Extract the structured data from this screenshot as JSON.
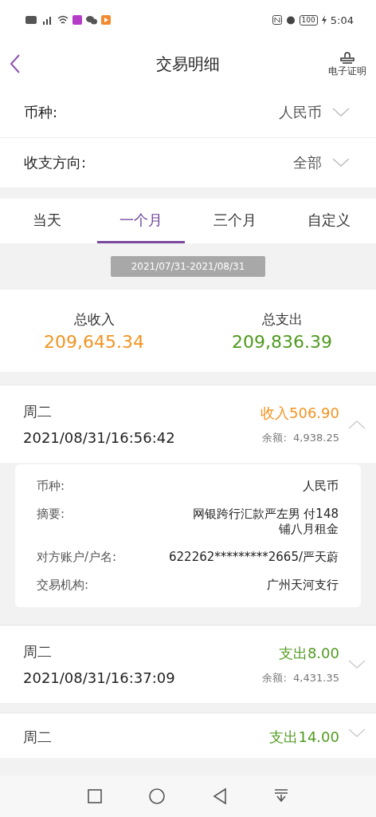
{
  "status_bar": {
    "time": "5:04",
    "battery": "100"
  },
  "header": {
    "title": "交易明细",
    "action": "电子证明"
  },
  "filters": [
    {
      "label": "币种:",
      "value": "人民币"
    },
    {
      "label": "收支方向:",
      "value": "全部"
    }
  ],
  "tabs": [
    {
      "label": "当天",
      "selected": false
    },
    {
      "label": "一个月",
      "selected": true
    },
    {
      "label": "三个月",
      "selected": false
    },
    {
      "label": "自定义",
      "selected": false
    }
  ],
  "date_range": "2021/07/31-2021/08/31",
  "totals": [
    {
      "label": "总收入",
      "amount": "209,645.34",
      "kind": "income"
    },
    {
      "label": "总支出",
      "amount": "209,836.39",
      "kind": "expense"
    }
  ],
  "transactions": [
    {
      "weekday": "周二",
      "time": "2021/08/31/16:56:42",
      "amount": "收入506.90",
      "kind": "income",
      "balance_label": "余额:",
      "balance": "4,938.25",
      "expanded": true,
      "details": [
        {
          "label": "币种:",
          "value": "人民币"
        },
        {
          "label": "摘要:",
          "value": "网银跨行汇款严左男 付148铺八月租金"
        },
        {
          "label": "对方账户/户名:",
          "value": "622262*********2665/严天蔚"
        },
        {
          "label": "交易机构:",
          "value": "广州天河支行"
        }
      ]
    },
    {
      "weekday": "周二",
      "time": "2021/08/31/16:37:09",
      "amount": "支出8.00",
      "kind": "expense",
      "balance_label": "余额:",
      "balance": "4,431.35",
      "expanded": false
    },
    {
      "weekday": "周二",
      "amount": "支出14.00",
      "kind": "expense",
      "expanded": false
    }
  ]
}
